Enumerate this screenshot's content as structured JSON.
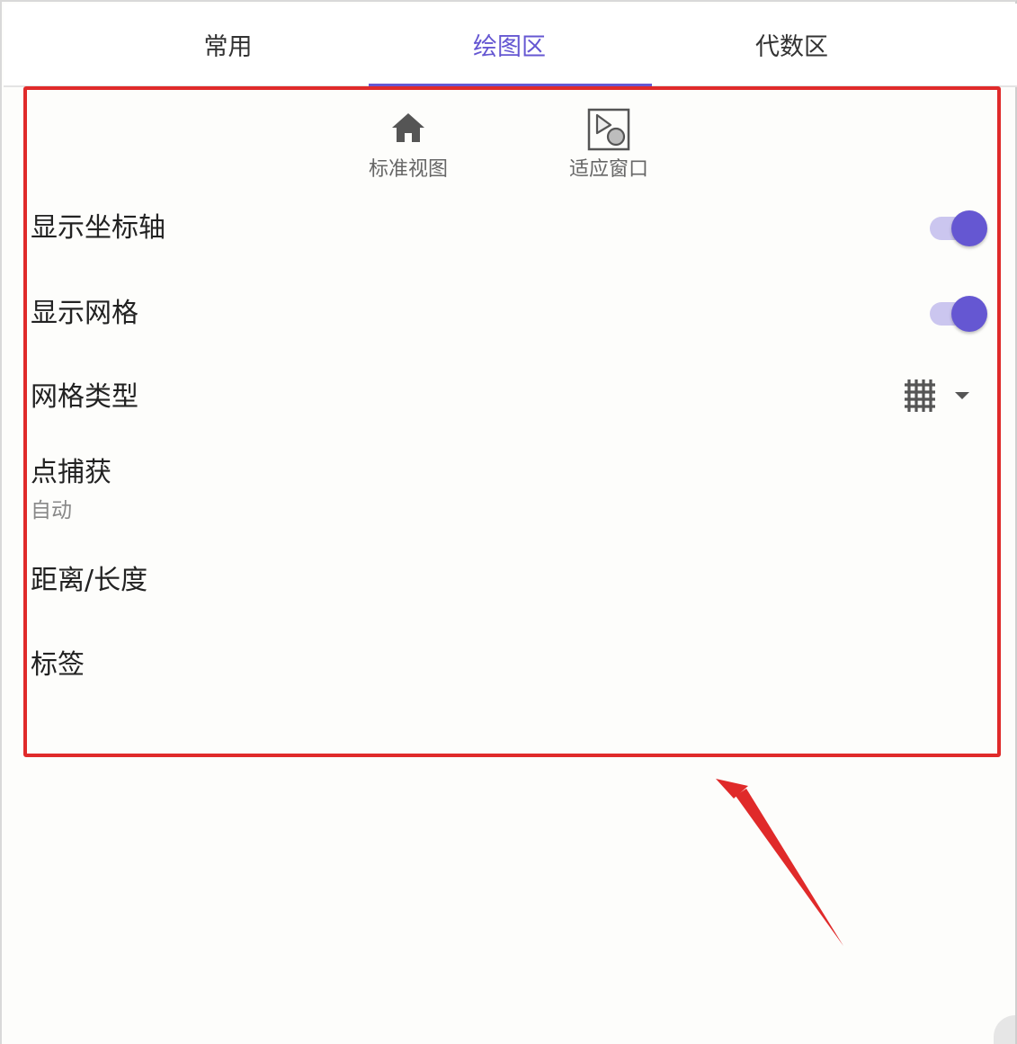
{
  "tabs": [
    {
      "label": "常用"
    },
    {
      "label": "绘图区"
    },
    {
      "label": "代数区"
    }
  ],
  "active_tab": "绘图区",
  "toolbar": {
    "standard_view": {
      "label": "标准视图",
      "icon": "home-icon"
    },
    "fit_window": {
      "label": "适应窗口",
      "icon": "fit-window-icon"
    }
  },
  "settings": {
    "show_axes": {
      "label": "显示坐标轴",
      "enabled": true
    },
    "show_grid": {
      "label": "显示网格",
      "enabled": true
    },
    "grid_type": {
      "label": "网格类型",
      "icon": "grid-icon"
    },
    "point_capture": {
      "label": "点捕获",
      "value": "自动"
    },
    "distance_length": {
      "label": "距离/长度"
    },
    "labels": {
      "label": "标签"
    }
  },
  "colors": {
    "accent": "#6557d2",
    "switch_track": "#cbc6ef",
    "annotation": "#e02a2a"
  }
}
